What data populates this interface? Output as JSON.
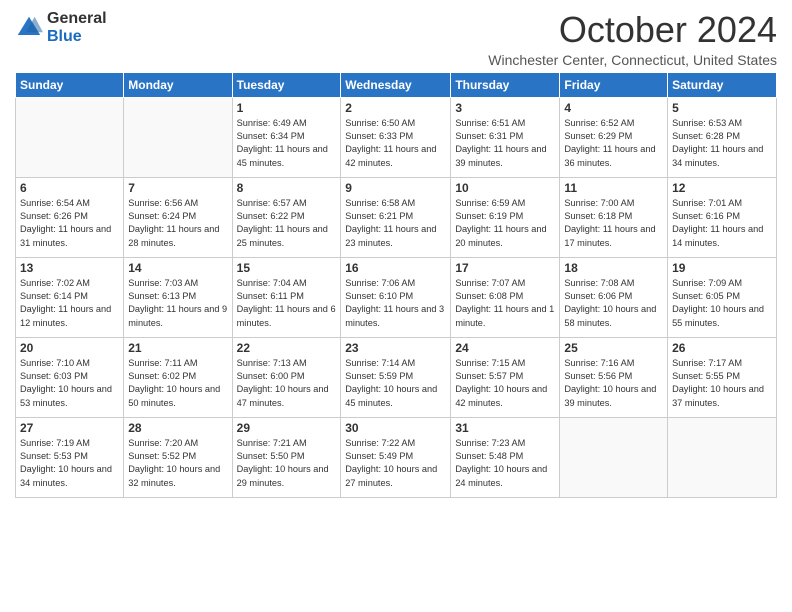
{
  "header": {
    "logo": {
      "general": "General",
      "blue": "Blue"
    },
    "title": "October 2024",
    "location": "Winchester Center, Connecticut, United States"
  },
  "calendar": {
    "headers": [
      "Sunday",
      "Monday",
      "Tuesday",
      "Wednesday",
      "Thursday",
      "Friday",
      "Saturday"
    ],
    "weeks": [
      [
        {
          "day": "",
          "info": ""
        },
        {
          "day": "",
          "info": ""
        },
        {
          "day": "1",
          "info": "Sunrise: 6:49 AM\nSunset: 6:34 PM\nDaylight: 11 hours and 45 minutes."
        },
        {
          "day": "2",
          "info": "Sunrise: 6:50 AM\nSunset: 6:33 PM\nDaylight: 11 hours and 42 minutes."
        },
        {
          "day": "3",
          "info": "Sunrise: 6:51 AM\nSunset: 6:31 PM\nDaylight: 11 hours and 39 minutes."
        },
        {
          "day": "4",
          "info": "Sunrise: 6:52 AM\nSunset: 6:29 PM\nDaylight: 11 hours and 36 minutes."
        },
        {
          "day": "5",
          "info": "Sunrise: 6:53 AM\nSunset: 6:28 PM\nDaylight: 11 hours and 34 minutes."
        }
      ],
      [
        {
          "day": "6",
          "info": "Sunrise: 6:54 AM\nSunset: 6:26 PM\nDaylight: 11 hours and 31 minutes."
        },
        {
          "day": "7",
          "info": "Sunrise: 6:56 AM\nSunset: 6:24 PM\nDaylight: 11 hours and 28 minutes."
        },
        {
          "day": "8",
          "info": "Sunrise: 6:57 AM\nSunset: 6:22 PM\nDaylight: 11 hours and 25 minutes."
        },
        {
          "day": "9",
          "info": "Sunrise: 6:58 AM\nSunset: 6:21 PM\nDaylight: 11 hours and 23 minutes."
        },
        {
          "day": "10",
          "info": "Sunrise: 6:59 AM\nSunset: 6:19 PM\nDaylight: 11 hours and 20 minutes."
        },
        {
          "day": "11",
          "info": "Sunrise: 7:00 AM\nSunset: 6:18 PM\nDaylight: 11 hours and 17 minutes."
        },
        {
          "day": "12",
          "info": "Sunrise: 7:01 AM\nSunset: 6:16 PM\nDaylight: 11 hours and 14 minutes."
        }
      ],
      [
        {
          "day": "13",
          "info": "Sunrise: 7:02 AM\nSunset: 6:14 PM\nDaylight: 11 hours and 12 minutes."
        },
        {
          "day": "14",
          "info": "Sunrise: 7:03 AM\nSunset: 6:13 PM\nDaylight: 11 hours and 9 minutes."
        },
        {
          "day": "15",
          "info": "Sunrise: 7:04 AM\nSunset: 6:11 PM\nDaylight: 11 hours and 6 minutes."
        },
        {
          "day": "16",
          "info": "Sunrise: 7:06 AM\nSunset: 6:10 PM\nDaylight: 11 hours and 3 minutes."
        },
        {
          "day": "17",
          "info": "Sunrise: 7:07 AM\nSunset: 6:08 PM\nDaylight: 11 hours and 1 minute."
        },
        {
          "day": "18",
          "info": "Sunrise: 7:08 AM\nSunset: 6:06 PM\nDaylight: 10 hours and 58 minutes."
        },
        {
          "day": "19",
          "info": "Sunrise: 7:09 AM\nSunset: 6:05 PM\nDaylight: 10 hours and 55 minutes."
        }
      ],
      [
        {
          "day": "20",
          "info": "Sunrise: 7:10 AM\nSunset: 6:03 PM\nDaylight: 10 hours and 53 minutes."
        },
        {
          "day": "21",
          "info": "Sunrise: 7:11 AM\nSunset: 6:02 PM\nDaylight: 10 hours and 50 minutes."
        },
        {
          "day": "22",
          "info": "Sunrise: 7:13 AM\nSunset: 6:00 PM\nDaylight: 10 hours and 47 minutes."
        },
        {
          "day": "23",
          "info": "Sunrise: 7:14 AM\nSunset: 5:59 PM\nDaylight: 10 hours and 45 minutes."
        },
        {
          "day": "24",
          "info": "Sunrise: 7:15 AM\nSunset: 5:57 PM\nDaylight: 10 hours and 42 minutes."
        },
        {
          "day": "25",
          "info": "Sunrise: 7:16 AM\nSunset: 5:56 PM\nDaylight: 10 hours and 39 minutes."
        },
        {
          "day": "26",
          "info": "Sunrise: 7:17 AM\nSunset: 5:55 PM\nDaylight: 10 hours and 37 minutes."
        }
      ],
      [
        {
          "day": "27",
          "info": "Sunrise: 7:19 AM\nSunset: 5:53 PM\nDaylight: 10 hours and 34 minutes."
        },
        {
          "day": "28",
          "info": "Sunrise: 7:20 AM\nSunset: 5:52 PM\nDaylight: 10 hours and 32 minutes."
        },
        {
          "day": "29",
          "info": "Sunrise: 7:21 AM\nSunset: 5:50 PM\nDaylight: 10 hours and 29 minutes."
        },
        {
          "day": "30",
          "info": "Sunrise: 7:22 AM\nSunset: 5:49 PM\nDaylight: 10 hours and 27 minutes."
        },
        {
          "day": "31",
          "info": "Sunrise: 7:23 AM\nSunset: 5:48 PM\nDaylight: 10 hours and 24 minutes."
        },
        {
          "day": "",
          "info": ""
        },
        {
          "day": "",
          "info": ""
        }
      ]
    ]
  }
}
